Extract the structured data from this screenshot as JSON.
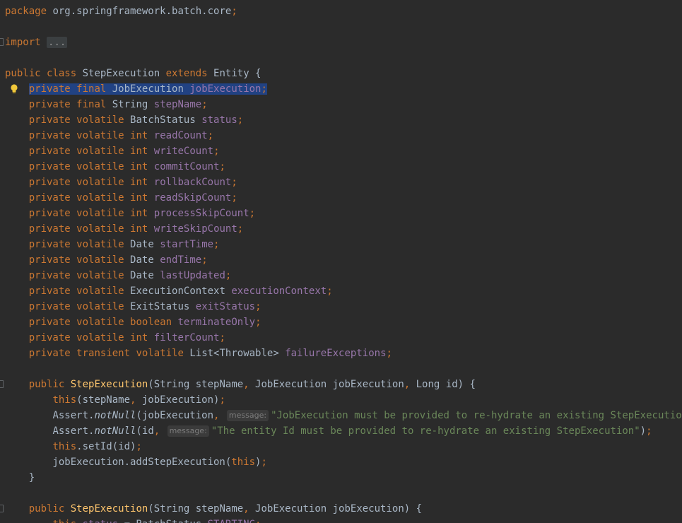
{
  "editor": {
    "theme_colors": {
      "background": "#2b2b2b",
      "keyword": "#cc7832",
      "field": "#9876aa",
      "method_declaration": "#ffc66d",
      "string": "#6a8759",
      "plain": "#a9b7c6",
      "selection": "#214283"
    },
    "lines": [
      {
        "tokens": [
          {
            "t": "package",
            "c": "kw"
          },
          {
            "t": " org.springframework.batch.core",
            "c": "plain"
          },
          {
            "t": ";",
            "c": "kw"
          }
        ]
      },
      {
        "tokens": []
      },
      {
        "fold": true,
        "tokens": [
          {
            "t": "import",
            "c": "kw"
          },
          {
            "t": " ",
            "c": "plain"
          },
          {
            "t": "...",
            "c": "folded"
          }
        ]
      },
      {
        "tokens": []
      },
      {
        "tokens": [
          {
            "t": "public",
            "c": "kw"
          },
          {
            "t": " ",
            "c": "plain"
          },
          {
            "t": "class",
            "c": "kw"
          },
          {
            "t": " StepExecution ",
            "c": "plain"
          },
          {
            "t": "extends",
            "c": "kw"
          },
          {
            "t": " Entity {",
            "c": "plain"
          }
        ]
      },
      {
        "icon": "lightbulb-icon",
        "tokens": [
          {
            "t": "    ",
            "c": "plain"
          },
          {
            "t": "private",
            "c": "kw",
            "sel": true
          },
          {
            "t": " ",
            "c": "plain",
            "sel": true
          },
          {
            "t": "final",
            "c": "kw",
            "sel": true
          },
          {
            "t": " JobExecution ",
            "c": "plain",
            "sel": true
          },
          {
            "t": "jobExecution",
            "c": "field",
            "sel": true
          },
          {
            "t": ";",
            "c": "kw",
            "sel": true
          }
        ]
      },
      {
        "tokens": [
          {
            "t": "    ",
            "c": "plain"
          },
          {
            "t": "private",
            "c": "kw"
          },
          {
            "t": " ",
            "c": "plain"
          },
          {
            "t": "final",
            "c": "kw"
          },
          {
            "t": " String ",
            "c": "plain"
          },
          {
            "t": "stepName",
            "c": "field"
          },
          {
            "t": ";",
            "c": "kw"
          }
        ]
      },
      {
        "tokens": [
          {
            "t": "    ",
            "c": "plain"
          },
          {
            "t": "private",
            "c": "kw"
          },
          {
            "t": " ",
            "c": "plain"
          },
          {
            "t": "volatile",
            "c": "kw"
          },
          {
            "t": " BatchStatus ",
            "c": "plain"
          },
          {
            "t": "status",
            "c": "field"
          },
          {
            "t": ";",
            "c": "kw"
          }
        ]
      },
      {
        "tokens": [
          {
            "t": "    ",
            "c": "plain"
          },
          {
            "t": "private",
            "c": "kw"
          },
          {
            "t": " ",
            "c": "plain"
          },
          {
            "t": "volatile",
            "c": "kw"
          },
          {
            "t": " ",
            "c": "plain"
          },
          {
            "t": "int",
            "c": "kw"
          },
          {
            "t": " ",
            "c": "plain"
          },
          {
            "t": "readCount",
            "c": "field"
          },
          {
            "t": ";",
            "c": "kw"
          }
        ]
      },
      {
        "tokens": [
          {
            "t": "    ",
            "c": "plain"
          },
          {
            "t": "private",
            "c": "kw"
          },
          {
            "t": " ",
            "c": "plain"
          },
          {
            "t": "volatile",
            "c": "kw"
          },
          {
            "t": " ",
            "c": "plain"
          },
          {
            "t": "int",
            "c": "kw"
          },
          {
            "t": " ",
            "c": "plain"
          },
          {
            "t": "writeCount",
            "c": "field"
          },
          {
            "t": ";",
            "c": "kw"
          }
        ]
      },
      {
        "tokens": [
          {
            "t": "    ",
            "c": "plain"
          },
          {
            "t": "private",
            "c": "kw"
          },
          {
            "t": " ",
            "c": "plain"
          },
          {
            "t": "volatile",
            "c": "kw"
          },
          {
            "t": " ",
            "c": "plain"
          },
          {
            "t": "int",
            "c": "kw"
          },
          {
            "t": " ",
            "c": "plain"
          },
          {
            "t": "commitCount",
            "c": "field"
          },
          {
            "t": ";",
            "c": "kw"
          }
        ]
      },
      {
        "tokens": [
          {
            "t": "    ",
            "c": "plain"
          },
          {
            "t": "private",
            "c": "kw"
          },
          {
            "t": " ",
            "c": "plain"
          },
          {
            "t": "volatile",
            "c": "kw"
          },
          {
            "t": " ",
            "c": "plain"
          },
          {
            "t": "int",
            "c": "kw"
          },
          {
            "t": " ",
            "c": "plain"
          },
          {
            "t": "rollbackCount",
            "c": "field"
          },
          {
            "t": ";",
            "c": "kw"
          }
        ]
      },
      {
        "tokens": [
          {
            "t": "    ",
            "c": "plain"
          },
          {
            "t": "private",
            "c": "kw"
          },
          {
            "t": " ",
            "c": "plain"
          },
          {
            "t": "volatile",
            "c": "kw"
          },
          {
            "t": " ",
            "c": "plain"
          },
          {
            "t": "int",
            "c": "kw"
          },
          {
            "t": " ",
            "c": "plain"
          },
          {
            "t": "readSkipCount",
            "c": "field"
          },
          {
            "t": ";",
            "c": "kw"
          }
        ]
      },
      {
        "tokens": [
          {
            "t": "    ",
            "c": "plain"
          },
          {
            "t": "private",
            "c": "kw"
          },
          {
            "t": " ",
            "c": "plain"
          },
          {
            "t": "volatile",
            "c": "kw"
          },
          {
            "t": " ",
            "c": "plain"
          },
          {
            "t": "int",
            "c": "kw"
          },
          {
            "t": " ",
            "c": "plain"
          },
          {
            "t": "processSkipCount",
            "c": "field"
          },
          {
            "t": ";",
            "c": "kw"
          }
        ]
      },
      {
        "tokens": [
          {
            "t": "    ",
            "c": "plain"
          },
          {
            "t": "private",
            "c": "kw"
          },
          {
            "t": " ",
            "c": "plain"
          },
          {
            "t": "volatile",
            "c": "kw"
          },
          {
            "t": " ",
            "c": "plain"
          },
          {
            "t": "int",
            "c": "kw"
          },
          {
            "t": " ",
            "c": "plain"
          },
          {
            "t": "writeSkipCount",
            "c": "field"
          },
          {
            "t": ";",
            "c": "kw"
          }
        ]
      },
      {
        "tokens": [
          {
            "t": "    ",
            "c": "plain"
          },
          {
            "t": "private",
            "c": "kw"
          },
          {
            "t": " ",
            "c": "plain"
          },
          {
            "t": "volatile",
            "c": "kw"
          },
          {
            "t": " Date ",
            "c": "plain"
          },
          {
            "t": "startTime",
            "c": "field"
          },
          {
            "t": ";",
            "c": "kw"
          }
        ]
      },
      {
        "tokens": [
          {
            "t": "    ",
            "c": "plain"
          },
          {
            "t": "private",
            "c": "kw"
          },
          {
            "t": " ",
            "c": "plain"
          },
          {
            "t": "volatile",
            "c": "kw"
          },
          {
            "t": " Date ",
            "c": "plain"
          },
          {
            "t": "endTime",
            "c": "field"
          },
          {
            "t": ";",
            "c": "kw"
          }
        ]
      },
      {
        "tokens": [
          {
            "t": "    ",
            "c": "plain"
          },
          {
            "t": "private",
            "c": "kw"
          },
          {
            "t": " ",
            "c": "plain"
          },
          {
            "t": "volatile",
            "c": "kw"
          },
          {
            "t": " Date ",
            "c": "plain"
          },
          {
            "t": "lastUpdated",
            "c": "field"
          },
          {
            "t": ";",
            "c": "kw"
          }
        ]
      },
      {
        "tokens": [
          {
            "t": "    ",
            "c": "plain"
          },
          {
            "t": "private",
            "c": "kw"
          },
          {
            "t": " ",
            "c": "plain"
          },
          {
            "t": "volatile",
            "c": "kw"
          },
          {
            "t": " ExecutionContext ",
            "c": "plain"
          },
          {
            "t": "executionContext",
            "c": "field"
          },
          {
            "t": ";",
            "c": "kw"
          }
        ]
      },
      {
        "tokens": [
          {
            "t": "    ",
            "c": "plain"
          },
          {
            "t": "private",
            "c": "kw"
          },
          {
            "t": " ",
            "c": "plain"
          },
          {
            "t": "volatile",
            "c": "kw"
          },
          {
            "t": " ExitStatus ",
            "c": "plain"
          },
          {
            "t": "exitStatus",
            "c": "field"
          },
          {
            "t": ";",
            "c": "kw"
          }
        ]
      },
      {
        "tokens": [
          {
            "t": "    ",
            "c": "plain"
          },
          {
            "t": "private",
            "c": "kw"
          },
          {
            "t": " ",
            "c": "plain"
          },
          {
            "t": "volatile",
            "c": "kw"
          },
          {
            "t": " ",
            "c": "plain"
          },
          {
            "t": "boolean",
            "c": "kw"
          },
          {
            "t": " ",
            "c": "plain"
          },
          {
            "t": "terminateOnly",
            "c": "field"
          },
          {
            "t": ";",
            "c": "kw"
          }
        ]
      },
      {
        "tokens": [
          {
            "t": "    ",
            "c": "plain"
          },
          {
            "t": "private",
            "c": "kw"
          },
          {
            "t": " ",
            "c": "plain"
          },
          {
            "t": "volatile",
            "c": "kw"
          },
          {
            "t": " ",
            "c": "plain"
          },
          {
            "t": "int",
            "c": "kw"
          },
          {
            "t": " ",
            "c": "plain"
          },
          {
            "t": "filterCount",
            "c": "field"
          },
          {
            "t": ";",
            "c": "kw"
          }
        ]
      },
      {
        "tokens": [
          {
            "t": "    ",
            "c": "plain"
          },
          {
            "t": "private",
            "c": "kw"
          },
          {
            "t": " ",
            "c": "plain"
          },
          {
            "t": "transient",
            "c": "kw"
          },
          {
            "t": " ",
            "c": "plain"
          },
          {
            "t": "volatile",
            "c": "kw"
          },
          {
            "t": " List<Throwable> ",
            "c": "plain"
          },
          {
            "t": "failureExceptions",
            "c": "field"
          },
          {
            "t": ";",
            "c": "kw"
          }
        ]
      },
      {
        "tokens": []
      },
      {
        "fold": true,
        "tokens": [
          {
            "t": "    ",
            "c": "plain"
          },
          {
            "t": "public",
            "c": "kw"
          },
          {
            "t": " ",
            "c": "plain"
          },
          {
            "t": "StepExecution",
            "c": "method"
          },
          {
            "t": "(String stepName",
            "c": "plain"
          },
          {
            "t": ",",
            "c": "kw"
          },
          {
            "t": " JobExecution jobExecution",
            "c": "plain"
          },
          {
            "t": ",",
            "c": "kw"
          },
          {
            "t": " Long id) {",
            "c": "plain"
          }
        ]
      },
      {
        "tokens": [
          {
            "t": "        ",
            "c": "plain"
          },
          {
            "t": "this",
            "c": "kw"
          },
          {
            "t": "(stepName",
            "c": "plain"
          },
          {
            "t": ",",
            "c": "kw"
          },
          {
            "t": " jobExecution)",
            "c": "plain"
          },
          {
            "t": ";",
            "c": "kw"
          }
        ]
      },
      {
        "tokens": [
          {
            "t": "        ",
            "c": "plain"
          },
          {
            "t": "Assert.",
            "c": "plain"
          },
          {
            "t": "notNull",
            "c": "static"
          },
          {
            "t": "(jobExecution",
            "c": "plain"
          },
          {
            "t": ",",
            "c": "kw"
          },
          {
            "t": " ",
            "c": "plain"
          },
          {
            "t": "message:",
            "c": "hint"
          },
          {
            "t": "\"JobExecution must be provided to re-hydrate an existing StepExecution\"",
            "c": "str"
          },
          {
            "t": ")",
            "c": "plain"
          },
          {
            "t": ";",
            "c": "kw"
          }
        ]
      },
      {
        "tokens": [
          {
            "t": "        ",
            "c": "plain"
          },
          {
            "t": "Assert.",
            "c": "plain"
          },
          {
            "t": "notNull",
            "c": "static"
          },
          {
            "t": "(id",
            "c": "plain"
          },
          {
            "t": ",",
            "c": "kw"
          },
          {
            "t": " ",
            "c": "plain"
          },
          {
            "t": "message:",
            "c": "hint"
          },
          {
            "t": "\"The entity Id must be provided to re-hydrate an existing StepExecution\"",
            "c": "str"
          },
          {
            "t": ")",
            "c": "plain"
          },
          {
            "t": ";",
            "c": "kw"
          }
        ]
      },
      {
        "tokens": [
          {
            "t": "        ",
            "c": "plain"
          },
          {
            "t": "this",
            "c": "kw"
          },
          {
            "t": ".setId(id)",
            "c": "plain"
          },
          {
            "t": ";",
            "c": "kw"
          }
        ]
      },
      {
        "tokens": [
          {
            "t": "        jobExecution.addStepExecution(",
            "c": "plain"
          },
          {
            "t": "this",
            "c": "kw"
          },
          {
            "t": ")",
            "c": "plain"
          },
          {
            "t": ";",
            "c": "kw"
          }
        ]
      },
      {
        "tokens": [
          {
            "t": "    }",
            "c": "plain"
          }
        ]
      },
      {
        "tokens": []
      },
      {
        "fold": true,
        "tokens": [
          {
            "t": "    ",
            "c": "plain"
          },
          {
            "t": "public",
            "c": "kw"
          },
          {
            "t": " ",
            "c": "plain"
          },
          {
            "t": "StepExecution",
            "c": "method"
          },
          {
            "t": "(String stepName",
            "c": "plain"
          },
          {
            "t": ",",
            "c": "kw"
          },
          {
            "t": " JobExecution jobExecution) {",
            "c": "plain"
          }
        ]
      },
      {
        "tokens": [
          {
            "t": "        ",
            "c": "plain"
          },
          {
            "t": "this",
            "c": "kw"
          },
          {
            "t": ".",
            "c": "plain"
          },
          {
            "t": "status",
            "c": "field"
          },
          {
            "t": " = BatchStatus.",
            "c": "plain"
          },
          {
            "t": "STARTING",
            "c": "field"
          },
          {
            "t": ";",
            "c": "kw"
          }
        ]
      }
    ]
  }
}
